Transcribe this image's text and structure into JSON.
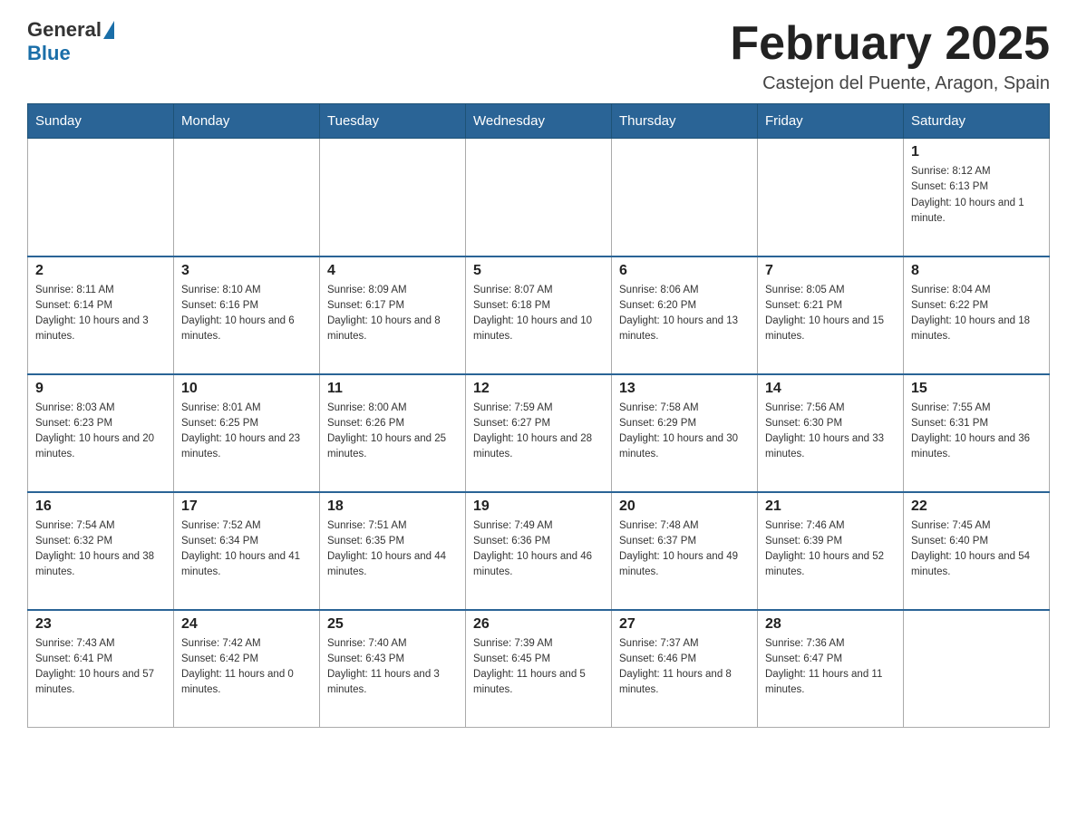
{
  "header": {
    "logo_general": "General",
    "logo_blue": "Blue",
    "title": "February 2025",
    "subtitle": "Castejon del Puente, Aragon, Spain"
  },
  "days_of_week": [
    "Sunday",
    "Monday",
    "Tuesday",
    "Wednesday",
    "Thursday",
    "Friday",
    "Saturday"
  ],
  "weeks": [
    [
      {
        "day": "",
        "info": ""
      },
      {
        "day": "",
        "info": ""
      },
      {
        "day": "",
        "info": ""
      },
      {
        "day": "",
        "info": ""
      },
      {
        "day": "",
        "info": ""
      },
      {
        "day": "",
        "info": ""
      },
      {
        "day": "1",
        "info": "Sunrise: 8:12 AM\nSunset: 6:13 PM\nDaylight: 10 hours and 1 minute."
      }
    ],
    [
      {
        "day": "2",
        "info": "Sunrise: 8:11 AM\nSunset: 6:14 PM\nDaylight: 10 hours and 3 minutes."
      },
      {
        "day": "3",
        "info": "Sunrise: 8:10 AM\nSunset: 6:16 PM\nDaylight: 10 hours and 6 minutes."
      },
      {
        "day": "4",
        "info": "Sunrise: 8:09 AM\nSunset: 6:17 PM\nDaylight: 10 hours and 8 minutes."
      },
      {
        "day": "5",
        "info": "Sunrise: 8:07 AM\nSunset: 6:18 PM\nDaylight: 10 hours and 10 minutes."
      },
      {
        "day": "6",
        "info": "Sunrise: 8:06 AM\nSunset: 6:20 PM\nDaylight: 10 hours and 13 minutes."
      },
      {
        "day": "7",
        "info": "Sunrise: 8:05 AM\nSunset: 6:21 PM\nDaylight: 10 hours and 15 minutes."
      },
      {
        "day": "8",
        "info": "Sunrise: 8:04 AM\nSunset: 6:22 PM\nDaylight: 10 hours and 18 minutes."
      }
    ],
    [
      {
        "day": "9",
        "info": "Sunrise: 8:03 AM\nSunset: 6:23 PM\nDaylight: 10 hours and 20 minutes."
      },
      {
        "day": "10",
        "info": "Sunrise: 8:01 AM\nSunset: 6:25 PM\nDaylight: 10 hours and 23 minutes."
      },
      {
        "day": "11",
        "info": "Sunrise: 8:00 AM\nSunset: 6:26 PM\nDaylight: 10 hours and 25 minutes."
      },
      {
        "day": "12",
        "info": "Sunrise: 7:59 AM\nSunset: 6:27 PM\nDaylight: 10 hours and 28 minutes."
      },
      {
        "day": "13",
        "info": "Sunrise: 7:58 AM\nSunset: 6:29 PM\nDaylight: 10 hours and 30 minutes."
      },
      {
        "day": "14",
        "info": "Sunrise: 7:56 AM\nSunset: 6:30 PM\nDaylight: 10 hours and 33 minutes."
      },
      {
        "day": "15",
        "info": "Sunrise: 7:55 AM\nSunset: 6:31 PM\nDaylight: 10 hours and 36 minutes."
      }
    ],
    [
      {
        "day": "16",
        "info": "Sunrise: 7:54 AM\nSunset: 6:32 PM\nDaylight: 10 hours and 38 minutes."
      },
      {
        "day": "17",
        "info": "Sunrise: 7:52 AM\nSunset: 6:34 PM\nDaylight: 10 hours and 41 minutes."
      },
      {
        "day": "18",
        "info": "Sunrise: 7:51 AM\nSunset: 6:35 PM\nDaylight: 10 hours and 44 minutes."
      },
      {
        "day": "19",
        "info": "Sunrise: 7:49 AM\nSunset: 6:36 PM\nDaylight: 10 hours and 46 minutes."
      },
      {
        "day": "20",
        "info": "Sunrise: 7:48 AM\nSunset: 6:37 PM\nDaylight: 10 hours and 49 minutes."
      },
      {
        "day": "21",
        "info": "Sunrise: 7:46 AM\nSunset: 6:39 PM\nDaylight: 10 hours and 52 minutes."
      },
      {
        "day": "22",
        "info": "Sunrise: 7:45 AM\nSunset: 6:40 PM\nDaylight: 10 hours and 54 minutes."
      }
    ],
    [
      {
        "day": "23",
        "info": "Sunrise: 7:43 AM\nSunset: 6:41 PM\nDaylight: 10 hours and 57 minutes."
      },
      {
        "day": "24",
        "info": "Sunrise: 7:42 AM\nSunset: 6:42 PM\nDaylight: 11 hours and 0 minutes."
      },
      {
        "day": "25",
        "info": "Sunrise: 7:40 AM\nSunset: 6:43 PM\nDaylight: 11 hours and 3 minutes."
      },
      {
        "day": "26",
        "info": "Sunrise: 7:39 AM\nSunset: 6:45 PM\nDaylight: 11 hours and 5 minutes."
      },
      {
        "day": "27",
        "info": "Sunrise: 7:37 AM\nSunset: 6:46 PM\nDaylight: 11 hours and 8 minutes."
      },
      {
        "day": "28",
        "info": "Sunrise: 7:36 AM\nSunset: 6:47 PM\nDaylight: 11 hours and 11 minutes."
      },
      {
        "day": "",
        "info": ""
      }
    ]
  ]
}
